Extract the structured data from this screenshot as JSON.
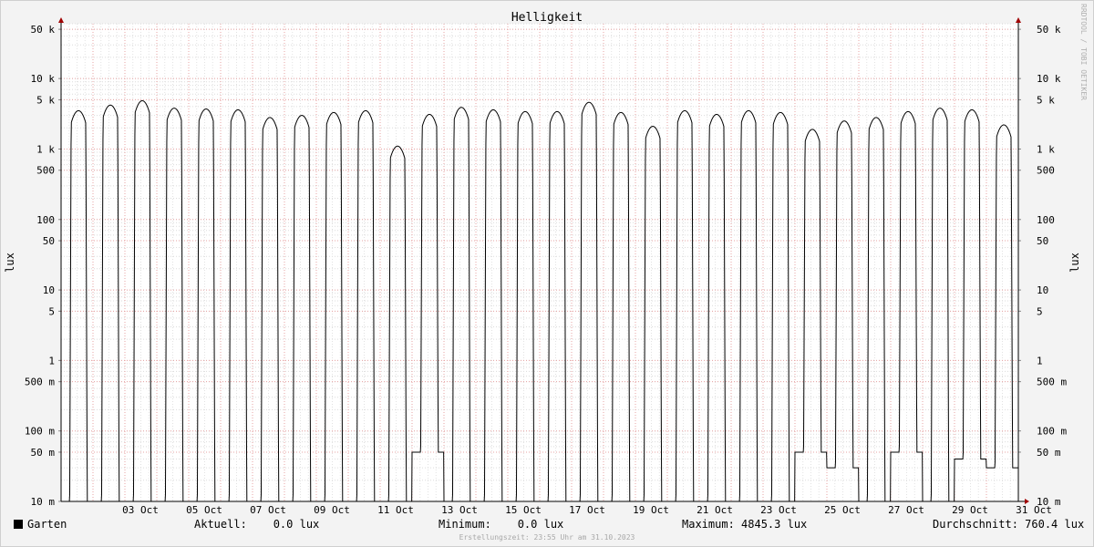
{
  "chart_data": {
    "type": "line",
    "title": "Helligkeit",
    "ylabel": "lux",
    "yscale": "log",
    "ylim": [
      0.01,
      60000
    ],
    "xlim": [
      0,
      30
    ],
    "grid": true,
    "y_ticks": [
      {
        "value": 50000,
        "label": "50 k"
      },
      {
        "value": 10000,
        "label": "10 k"
      },
      {
        "value": 5000,
        "label": "5 k"
      },
      {
        "value": 1000,
        "label": "1 k"
      },
      {
        "value": 500,
        "label": "500"
      },
      {
        "value": 100,
        "label": "100"
      },
      {
        "value": 50,
        "label": "50"
      },
      {
        "value": 10,
        "label": "10"
      },
      {
        "value": 5,
        "label": "5"
      },
      {
        "value": 1,
        "label": "1"
      },
      {
        "value": 0.5,
        "label": "500 m"
      },
      {
        "value": 0.1,
        "label": "100 m"
      },
      {
        "value": 0.05,
        "label": "50 m"
      },
      {
        "value": 0.01,
        "label": "10 m"
      }
    ],
    "x_ticks": [
      {
        "day": 2,
        "label": "03 Oct"
      },
      {
        "day": 4,
        "label": "05 Oct"
      },
      {
        "day": 6,
        "label": "07 Oct"
      },
      {
        "day": 8,
        "label": "09 Oct"
      },
      {
        "day": 10,
        "label": "11 Oct"
      },
      {
        "day": 12,
        "label": "13 Oct"
      },
      {
        "day": 14,
        "label": "15 Oct"
      },
      {
        "day": 16,
        "label": "17 Oct"
      },
      {
        "day": 18,
        "label": "19 Oct"
      },
      {
        "day": 20,
        "label": "21 Oct"
      },
      {
        "day": 22,
        "label": "23 Oct"
      },
      {
        "day": 24,
        "label": "25 Oct"
      },
      {
        "day": 26,
        "label": "27 Oct"
      },
      {
        "day": 28,
        "label": "29 Oct"
      },
      {
        "day": 30,
        "label": "31 Oct"
      }
    ],
    "series": [
      {
        "name": "Garten",
        "color": "#000000",
        "daily_peak_lux": [
          3500,
          4200,
          4845.3,
          3800,
          3700,
          3600,
          2800,
          3000,
          3300,
          3500,
          1100,
          3100,
          3900,
          3600,
          3400,
          3400,
          4600,
          3300,
          2100,
          3500,
          3100,
          3500,
          3300,
          1900,
          2500,
          2800,
          3400,
          3800,
          3600,
          2200
        ],
        "daily_night_floor_lux": [
          0.01,
          0.01,
          0.01,
          0.01,
          0.01,
          0.01,
          0.01,
          0.01,
          0.01,
          0.01,
          0.01,
          0.05,
          0.01,
          0.01,
          0.01,
          0.01,
          0.01,
          0.01,
          0.01,
          0.01,
          0.01,
          0.01,
          0.01,
          0.05,
          0.03,
          0.01,
          0.05,
          0.01,
          0.04,
          0.03
        ]
      }
    ]
  },
  "legend": {
    "name": "Garten"
  },
  "stats": {
    "current": "Aktuell:    0.0 lux",
    "minimum": "Minimum:    0.0 lux",
    "maximum": "Maximum: 4845.3 lux",
    "average": "Durchschnitt: 760.4 lux"
  },
  "stamp": "Erstellungszeit: 23:55 Uhr am 31.10.2023",
  "watermark": "RRDTOOL / TOBI OETIKER"
}
